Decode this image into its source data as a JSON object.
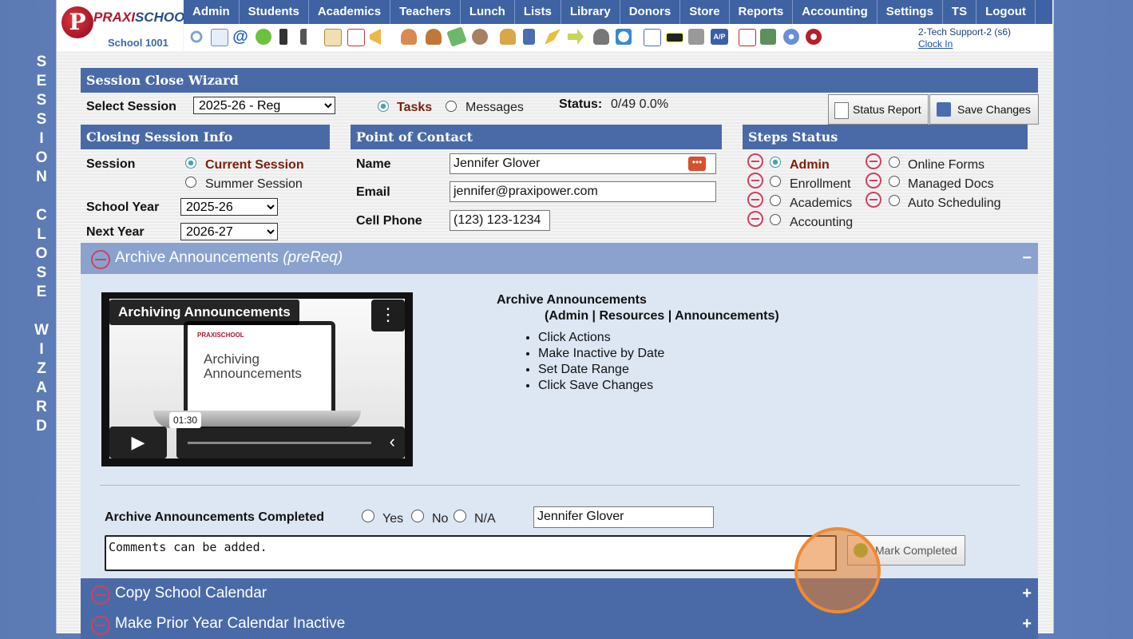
{
  "side_title": [
    "S",
    "E",
    "S",
    "S",
    "I",
    "O",
    "N",
    "",
    "C",
    "L",
    "O",
    "S",
    "E",
    "",
    "W",
    "I",
    "Z",
    "A",
    "R",
    "D"
  ],
  "logo": {
    "letter": "P",
    "brand_a": "PRAXI",
    "brand_b": "SCHOOL",
    "tm": "™",
    "school": "School 1001"
  },
  "nav": [
    "Admin",
    "Students",
    "Academics",
    "Teachers",
    "Lunch",
    "Lists",
    "Library",
    "Donors",
    "Store",
    "Reports",
    "Accounting",
    "Settings",
    "TS",
    "Logout"
  ],
  "user": {
    "name": "2-Tech Support-2 (s6)",
    "clock_link": "Clock In"
  },
  "wizard": {
    "title": "Session Close Wizard",
    "select_session_label": "Select Session",
    "select_session_value": "2025-26 - Reg",
    "tasks_label": "Tasks",
    "messages_label": "Messages",
    "status_label": "Status:",
    "status_value": "0/49  0.0%",
    "status_report_btn": "Status Report",
    "save_changes_btn": "Save Changes"
  },
  "closing": {
    "title": "Closing Session Info",
    "session_label": "Session",
    "current_session": "Current Session",
    "summer_session": "Summer Session",
    "school_year_label": "School Year",
    "school_year_value": "2025-26",
    "next_year_label": "Next Year",
    "next_year_value": "2026-27"
  },
  "contact": {
    "title": "Point of Contact",
    "name_label": "Name",
    "name_value": "Jennifer Glover",
    "email_label": "Email",
    "email_value": "jennifer@praxipower.com",
    "phone_label": "Cell Phone",
    "phone_value": "(123) 123-1234"
  },
  "steps": {
    "title": "Steps Status",
    "items_left": [
      "Admin",
      "Enrollment",
      "Academics",
      "Accounting"
    ],
    "items_right": [
      "Online Forms",
      "Managed Docs",
      "Auto Scheduling"
    ]
  },
  "archive": {
    "header": "Archive Announcements",
    "header_suffix": "(preReq)",
    "toggle": "−",
    "video_title": "Archiving Announcements",
    "video_screen_logo": "PRAXISCHOOL",
    "video_screen_text_1": "Archiving",
    "video_screen_text_2": "Announcements",
    "video_time": "01:30",
    "instr_title": "Archive Announcements",
    "instr_path": "(Admin  |  Resources  |  Announcements)",
    "steps": [
      "Click Actions",
      "Make Inactive by Date",
      "Set Date Range",
      "Click Save Changes"
    ],
    "completed_label": "Archive Announcements Completed",
    "yes": "Yes",
    "no": "No",
    "na": "N/A",
    "completed_by": "Jennifer Glover",
    "comments": "Comments can be added.",
    "mark_completed_btn": "Mark Completed"
  },
  "sections": [
    {
      "label": "Copy School Calendar",
      "toggle": "+"
    },
    {
      "label": "Make Prior Year Calendar Inactive",
      "toggle": "+"
    }
  ]
}
